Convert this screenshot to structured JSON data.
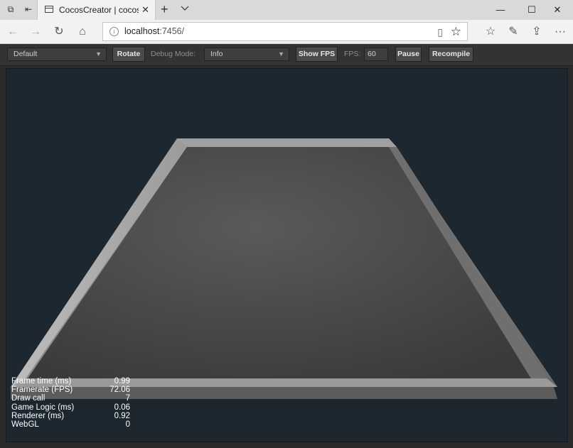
{
  "browser": {
    "tab_title": "CocosCreator | cocos-cr",
    "url_host": "localhost",
    "url_rest": ":7456/"
  },
  "toolbar": {
    "scene_select": "Default",
    "rotate_label": "Rotate",
    "debug_mode_label": "Debug Mode:",
    "debug_mode_value": "Info",
    "show_fps_label": "Show FPS",
    "fps_label": "FPS:",
    "fps_value": "60",
    "pause_label": "Pause",
    "recompile_label": "Recompile"
  },
  "stats": [
    {
      "label": "Frame time (ms)",
      "value": "0.99"
    },
    {
      "label": "Framerate (FPS)",
      "value": "72.06"
    },
    {
      "label": "Draw call",
      "value": "7"
    },
    {
      "label": "Game Logic (ms)",
      "value": "0.06"
    },
    {
      "label": "Renderer (ms)",
      "value": "0.92"
    },
    {
      "label": "WebGL",
      "value": "0"
    }
  ],
  "colors": {
    "stage_bg": "#1c2730",
    "toolbar_bg": "#333333",
    "board_surface": "#4a4a4a"
  }
}
